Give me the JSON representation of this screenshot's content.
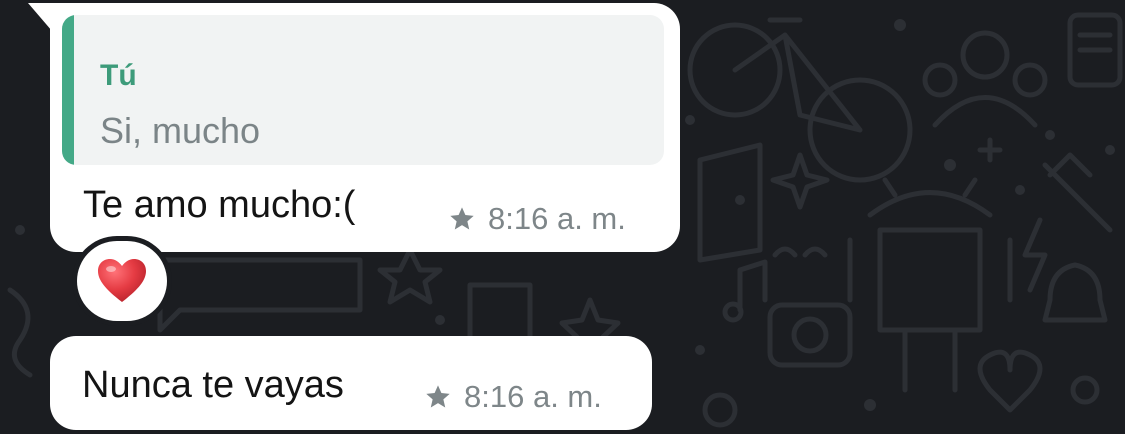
{
  "chat": {
    "background_color": "#1b1d21",
    "bubble_color": "#ffffff"
  },
  "messages": [
    {
      "reply": {
        "author": "Tú",
        "text": "Si, mucho",
        "accent_color": "#44a987"
      },
      "text": "Te amo mucho:(",
      "time": "8:16 a. m.",
      "starred": true,
      "star_icon": "star-icon",
      "reaction": {
        "emoji_icon": "red-heart-icon",
        "color": "#e53b43"
      }
    },
    {
      "text": "Nunca te vayas",
      "time": "8:16 a. m.",
      "starred": true,
      "star_icon": "star-icon"
    }
  ]
}
